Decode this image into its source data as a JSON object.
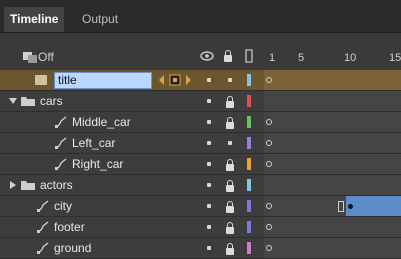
{
  "tabs": [
    {
      "label": "Timeline",
      "active": true
    },
    {
      "label": "Output",
      "active": false
    }
  ],
  "header": {
    "onion_label": "Off",
    "ruler_ticks": [
      "1",
      "5",
      "10",
      "15"
    ]
  },
  "layers": [
    {
      "name": "title",
      "selected": true,
      "editing": true,
      "color": "#7ec8e3"
    },
    {
      "name": "cars",
      "type": "folder",
      "expanded": true,
      "color": "#e05050"
    },
    {
      "name": "Middle_car",
      "type": "motion",
      "color": "#5ec85e"
    },
    {
      "name": "Left_car",
      "type": "motion",
      "color": "#9b7fd6"
    },
    {
      "name": "Right_car",
      "type": "motion",
      "color": "#f0a030"
    },
    {
      "name": "actors",
      "type": "folder",
      "expanded": false,
      "color": "#7ec8e3"
    },
    {
      "name": "city",
      "type": "motion",
      "color": "#7a7adf"
    },
    {
      "name": "footer",
      "type": "motion",
      "color": "#7a7adf"
    },
    {
      "name": "ground",
      "type": "motion",
      "color": "#d07ad0"
    }
  ],
  "colors": {
    "selected_row": "#6b5630",
    "tween": "#5b8ec9",
    "background": "#3a3a3a"
  }
}
